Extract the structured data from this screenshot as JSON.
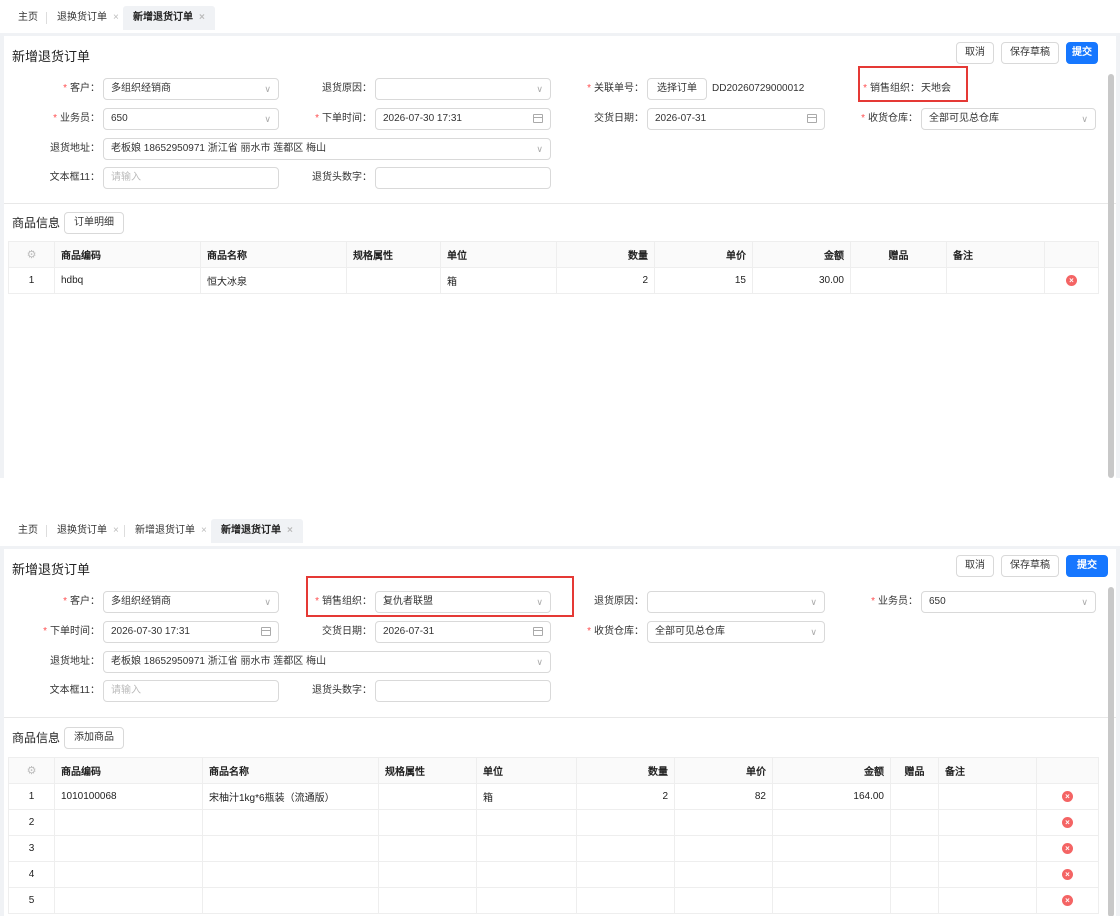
{
  "screen1": {
    "tabs": [
      {
        "label": "主页",
        "closable": false
      },
      {
        "label": "退换货订单",
        "closable": true
      },
      {
        "label": "新增退货订单",
        "closable": true,
        "active": true
      }
    ],
    "title": "新增退货订单",
    "buttons": {
      "cancel": "取消",
      "save_draft": "保存草稿",
      "submit": "提交"
    },
    "form": {
      "customer": {
        "label": "客户：",
        "value": "多组织经销商",
        "required": true
      },
      "return_reason": {
        "label": "退货原因：",
        "value": ""
      },
      "related_no": {
        "label": "关联单号：",
        "button": "选择订单",
        "value": "DD20260729000012",
        "required": true
      },
      "sales_org": {
        "label": "销售组织：",
        "value": "天地会",
        "required": true
      },
      "salesman": {
        "label": "业务员：",
        "value": "650",
        "required": true
      },
      "order_time": {
        "label": "下单时间：",
        "value": "2026-07-30 17:31",
        "required": true
      },
      "delivery_date": {
        "label": "交货日期：",
        "value": "2026-07-31"
      },
      "warehouse": {
        "label": "收货仓库：",
        "value": "全部可见总仓库",
        "required": true
      },
      "address": {
        "label": "退货地址：",
        "value": "老板娘 18652950971 浙江省 丽水市 莲都区 梅山"
      },
      "textbox11": {
        "label": "文本框11：",
        "placeholder": "请输入"
      },
      "return_head_number": {
        "label": "退货头数字：",
        "value": ""
      }
    },
    "section_title": "商品信息",
    "section_button": "订单明细",
    "table": {
      "headers": [
        "商品编码",
        "商品名称",
        "规格属性",
        "单位",
        "数量",
        "单价",
        "金额",
        "赠品",
        "备注"
      ],
      "rows": [
        {
          "idx": "1",
          "code": "hdbq",
          "name": "恒大冰泉",
          "spec": "",
          "unit": "箱",
          "qty": "2",
          "price": "15",
          "amount": "30.00",
          "gift": "",
          "remark": ""
        }
      ]
    }
  },
  "screen2": {
    "tabs": [
      {
        "label": "主页",
        "closable": false
      },
      {
        "label": "退换货订单",
        "closable": true
      },
      {
        "label": "新增退货订单",
        "closable": true
      },
      {
        "label": "新增退货订单",
        "closable": true,
        "active": true
      }
    ],
    "title": "新增退货订单",
    "buttons": {
      "cancel": "取消",
      "save_draft": "保存草稿",
      "submit": "提交"
    },
    "form": {
      "customer": {
        "label": "客户：",
        "value": "多组织经销商",
        "required": true
      },
      "sales_org": {
        "label": "销售组织：",
        "value": "复仇者联盟",
        "required": true
      },
      "return_reason": {
        "label": "退货原因：",
        "value": ""
      },
      "salesman": {
        "label": "业务员：",
        "value": "650",
        "required": true
      },
      "order_time": {
        "label": "下单时间：",
        "value": "2026-07-30 17:31",
        "required": true
      },
      "delivery_date": {
        "label": "交货日期：",
        "value": "2026-07-31"
      },
      "warehouse": {
        "label": "收货仓库：",
        "value": "全部可见总仓库",
        "required": true
      },
      "address": {
        "label": "退货地址：",
        "value": "老板娘 18652950971 浙江省 丽水市 莲都区 梅山"
      },
      "textbox11": {
        "label": "文本框11：",
        "placeholder": "请输入"
      },
      "return_head_number": {
        "label": "退货头数字：",
        "value": ""
      }
    },
    "section_title": "商品信息",
    "section_button": "添加商品",
    "table": {
      "headers": [
        "商品编码",
        "商品名称",
        "规格属性",
        "单位",
        "数量",
        "单价",
        "金额",
        "赠品",
        "备注"
      ],
      "rows": [
        {
          "idx": "1",
          "code": "1010100068",
          "name": "宋柚汁1kg*6瓶装（流通版）",
          "spec": "",
          "unit": "箱",
          "qty": "2",
          "price": "82",
          "amount": "164.00",
          "gift": "",
          "remark": ""
        },
        {
          "idx": "2",
          "code": "",
          "name": "",
          "spec": "",
          "unit": "",
          "qty": "",
          "price": "",
          "amount": "",
          "gift": "",
          "remark": ""
        },
        {
          "idx": "3",
          "code": "",
          "name": "",
          "spec": "",
          "unit": "",
          "qty": "",
          "price": "",
          "amount": "",
          "gift": "",
          "remark": ""
        },
        {
          "idx": "4",
          "code": "",
          "name": "",
          "spec": "",
          "unit": "",
          "qty": "",
          "price": "",
          "amount": "",
          "gift": "",
          "remark": ""
        },
        {
          "idx": "5",
          "code": "",
          "name": "",
          "spec": "",
          "unit": "",
          "qty": "",
          "price": "",
          "amount": "",
          "gift": "",
          "remark": ""
        }
      ]
    }
  },
  "highlight_color": "#e53935",
  "primary_color": "#1677ff",
  "delete_icon_color": "#f46464"
}
